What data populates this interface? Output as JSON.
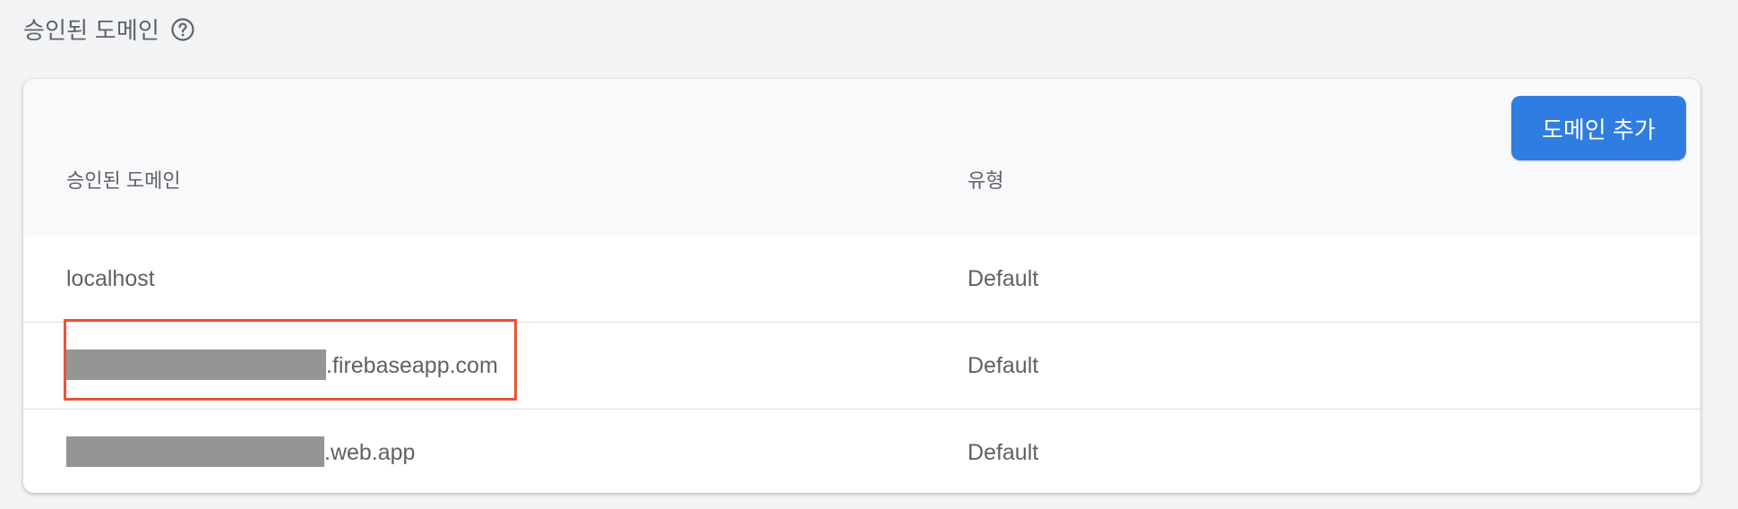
{
  "section": {
    "title": "승인된 도메인",
    "help_icon": "help-circle-icon"
  },
  "toolbar": {
    "add_domain_label": "도메인 추가"
  },
  "table": {
    "columns": [
      "승인된 도메인",
      "유형"
    ],
    "rows": [
      {
        "domain_redacted": false,
        "domain_suffix": "localhost",
        "type": "Default"
      },
      {
        "domain_redacted": true,
        "domain_suffix": ".firebaseapp.com",
        "type": "Default"
      },
      {
        "domain_redacted": true,
        "domain_suffix": ".web.app",
        "type": "Default"
      }
    ]
  },
  "colors": {
    "primary_button": "#2f7de1",
    "highlight_border": "#e8543a",
    "redaction": "#959595"
  }
}
